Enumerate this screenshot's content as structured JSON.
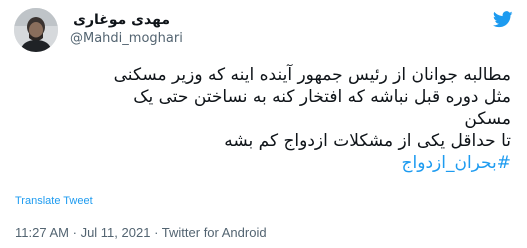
{
  "tweet": {
    "author": {
      "display_name": "مهدی موغاری",
      "handle": "@Mahdi_moghari"
    },
    "body_lines": [
      "مطالبه جوانان از رئیس جمهور آینده اینه که وزیر مسکنی",
      "مثل دوره قبل نباشه که افتخار کنه به نساختن حتی یک",
      "مسکن",
      "تا حداقل یکی از مشکلات ازدواج کم بشه"
    ],
    "hashtag": "#بحران_ازدواج",
    "translate_label": "Translate Tweet",
    "time": "11:27 AM",
    "separator": "·",
    "date": "Jul 11, 2021",
    "source": "Twitter for Android"
  },
  "icons": {
    "brand": "twitter-bird-icon",
    "avatar": "user-avatar-photo"
  },
  "colors": {
    "accent": "#1d9bf0",
    "text": "#0f1419",
    "secondary": "#536471"
  }
}
